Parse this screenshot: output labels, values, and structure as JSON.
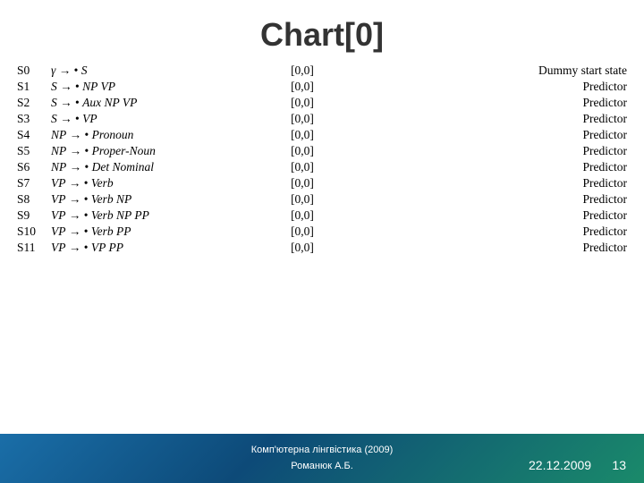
{
  "title": "Chart[0]",
  "rows": [
    {
      "state": "S0",
      "lhs": "γ",
      "arrow": "→",
      "dot": "•",
      "rhs": "S",
      "range": "[0,0]",
      "label": "Dummy start state"
    },
    {
      "state": "S1",
      "lhs": "S",
      "arrow": "→",
      "dot": "•",
      "rhs": "NP VP",
      "range": "[0,0]",
      "label": "Predictor"
    },
    {
      "state": "S2",
      "lhs": "S",
      "arrow": "→",
      "dot": "•",
      "rhs": "Aux NP VP",
      "range": "[0,0]",
      "label": "Predictor"
    },
    {
      "state": "S3",
      "lhs": "S",
      "arrow": "→",
      "dot": "•",
      "rhs": "VP",
      "range": "[0,0]",
      "label": "Predictor"
    },
    {
      "state": "S4",
      "lhs": "NP",
      "arrow": "→",
      "dot": "•",
      "rhs": "Pronoun",
      "range": "[0,0]",
      "label": "Predictor"
    },
    {
      "state": "S5",
      "lhs": "NP",
      "arrow": "→",
      "dot": "•",
      "rhs": "Proper-Noun",
      "range": "[0,0]",
      "label": "Predictor"
    },
    {
      "state": "S6",
      "lhs": "NP",
      "arrow": "→",
      "dot": "•",
      "rhs": "Det Nominal",
      "range": "[0,0]",
      "label": "Predictor"
    },
    {
      "state": "S7",
      "lhs": "VP",
      "arrow": "→",
      "dot": "•",
      "rhs": "Verb",
      "range": "[0,0]",
      "label": "Predictor"
    },
    {
      "state": "S8",
      "lhs": "VP",
      "arrow": "→",
      "dot": "•",
      "rhs": "Verb NP",
      "range": "[0,0]",
      "label": "Predictor"
    },
    {
      "state": "S9",
      "lhs": "VP",
      "arrow": "→",
      "dot": "•",
      "rhs": "Verb NP PP",
      "range": "[0,0]",
      "label": "Predictor"
    },
    {
      "state": "S10",
      "lhs": "VP",
      "arrow": "→",
      "dot": "•",
      "rhs": "Verb PP",
      "range": "[0,0]",
      "label": "Predictor"
    },
    {
      "state": "S11",
      "lhs": "VP",
      "arrow": "→",
      "dot": "•",
      "rhs": "VP PP",
      "range": "[0,0]",
      "label": "Predictor"
    }
  ],
  "footer": {
    "line1": "Комп'ютерна лінгвістика (2009)",
    "line2": "Романюк А.Б.",
    "date": "22.12.2009",
    "page": "13"
  }
}
